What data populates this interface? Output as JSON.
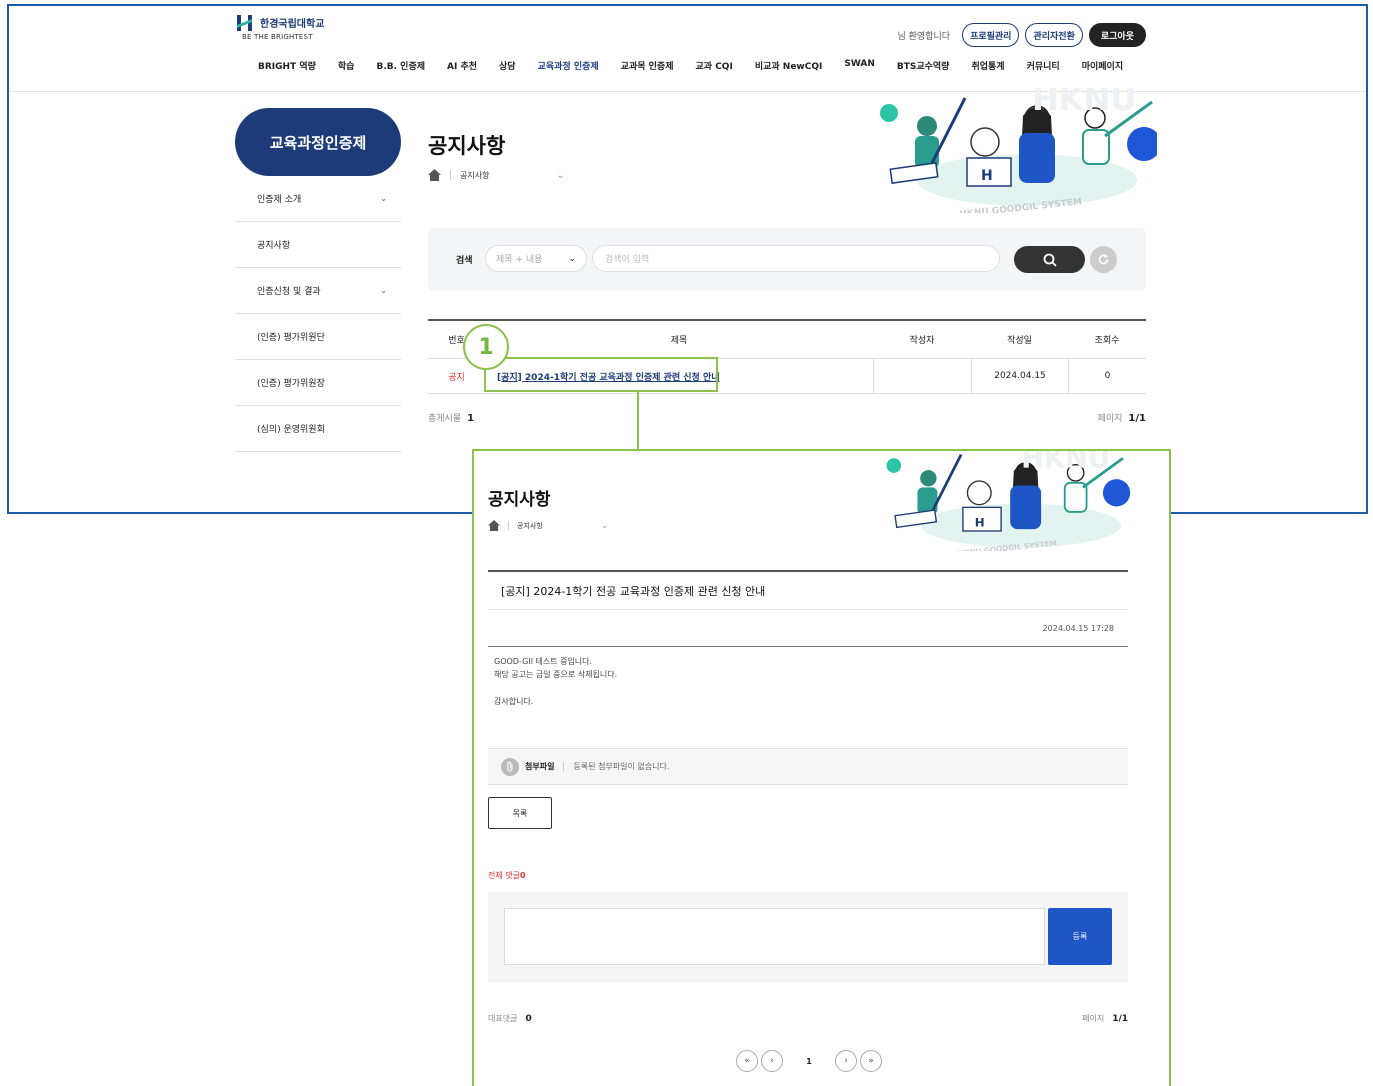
{
  "header": {
    "logo_name": "한경국립대학교",
    "logo_sub": "BE THE BRIGHTEST",
    "welcome": "님 환영합니다",
    "profile_btn": "프로필관리",
    "admin_btn": "관리자전환",
    "logout_btn": "로그아웃",
    "nav": [
      "BRIGHT 역량",
      "학습",
      "B.B. 인증제",
      "AI 추천",
      "상담",
      "교육과정 인증제",
      "교과목 인증제",
      "교과 CQI",
      "비교과 NewCQI",
      "SWAN",
      "BTS교수역량",
      "취업통계",
      "커뮤니티",
      "마이페이지"
    ]
  },
  "sidebar": {
    "title": "교육과정인증제",
    "items": [
      {
        "label": "인증제 소개",
        "chevron": "⌄"
      },
      {
        "label": "공지사항",
        "chevron": ""
      },
      {
        "label": "인증신청 및 결과",
        "chevron": "⌄"
      },
      {
        "label": "(인증) 평가위원단",
        "chevron": ""
      },
      {
        "label": "(인증) 평가위원장",
        "chevron": ""
      },
      {
        "label": "(심의) 운영위원회",
        "chevron": ""
      }
    ]
  },
  "main": {
    "page_title": "공지사항",
    "breadcrumb": "공지사항",
    "hero_text": "HKNU GOODGIL SYSTEM",
    "search": {
      "label": "검색",
      "select_value": "제목 + 내용",
      "input_placeholder": "검색어 입력"
    },
    "board": {
      "headers": {
        "num": "번호",
        "title": "제목",
        "writer": "작성자",
        "date": "작성일",
        "views": "조회수"
      },
      "rows": [
        {
          "num": "공지",
          "title": "[공지] 2024-1학기 전공 교육과정 인증제 관련 신청 안내",
          "writer": "",
          "date": "2024.04.15",
          "views": "0"
        }
      ],
      "total_label": "총게시물",
      "total": "1",
      "page_label": "페이지",
      "page": "1/1"
    }
  },
  "annotation": {
    "step": "1",
    "color": "#8cc14c"
  },
  "detail": {
    "page_title": "공지사항",
    "breadcrumb": "공지사항",
    "post_title": "[공지] 2024-1학기 전공 교육과정 인증제 관련 신청 안내",
    "post_date": "2024.04.15 17:28",
    "body_line1": "GOOD-GIl 테스트 중입니다.",
    "body_line2": "해당 공고는 금일 중으로 삭제됩니다.",
    "body_line3": "감사합니다.",
    "attach_label": "첨부파일",
    "attach_text": "등록된 첨부파일이 없습니다.",
    "list_btn": "목록",
    "comment_label": "전체 댓글",
    "comment_count": "0",
    "submit_btn": "등록",
    "rep_comment_label": "대표댓글",
    "rep_comment_count": "0",
    "page_label": "페이지",
    "page": "1/1",
    "pager": {
      "first": "«",
      "prev": "‹",
      "current": "1",
      "next": "›",
      "last": "»"
    }
  }
}
